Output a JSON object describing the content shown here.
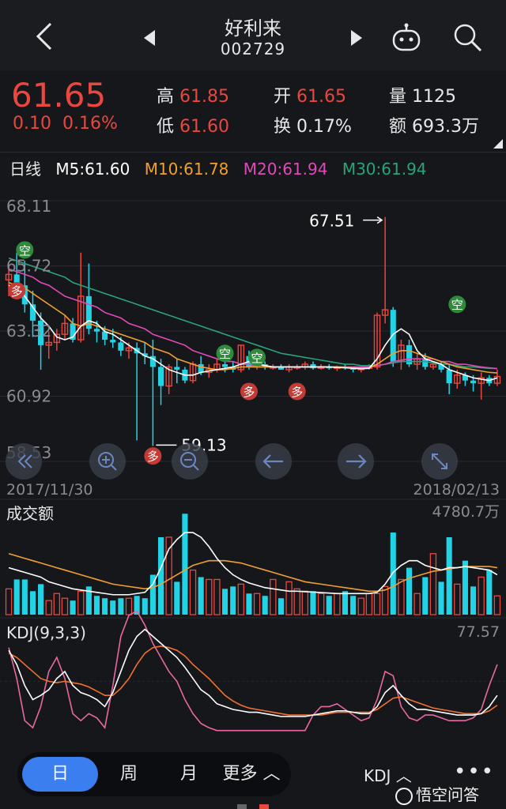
{
  "header": {
    "back_icon": "chevron-left-icon",
    "prev_icon": "triangle-left-icon",
    "next_icon": "triangle-right-icon",
    "title": "好利来",
    "code": "002729",
    "robot_icon": "robot-icon",
    "search_icon": "search-icon"
  },
  "quote": {
    "price": "61.65",
    "change": "0.10",
    "change_pct": "0.16%",
    "high_label": "高",
    "high": "61.85",
    "low_label": "低",
    "low": "61.60",
    "open_label": "开",
    "open": "61.65",
    "turnover_label": "换",
    "turnover": "0.17%",
    "volume_label": "量",
    "volume": "1125",
    "amount_label": "额",
    "amount": "693.3万"
  },
  "ma_bar": {
    "period": "日线",
    "m5": "M5:61.60",
    "m10": "M10:61.78",
    "m20": "M20:61.94",
    "m30": "M30:61.94",
    "colors": {
      "m5": "#ffffff",
      "m10": "#f0a030",
      "m20": "#e04ab8",
      "m30": "#2aa37a"
    }
  },
  "chart_data": [
    {
      "type": "candlestick",
      "y_ticks": [
        "68.11",
        "65.72",
        "63.32",
        "60.92",
        "58.53"
      ],
      "ylim": [
        58.53,
        68.11
      ],
      "x_start": "2017/11/30",
      "x_end": "2018/02/13",
      "annotations": {
        "max_label": "67.51",
        "min_label": "59.13"
      },
      "markers": {
        "short": "空",
        "long": "多"
      },
      "candles": [
        [
          65.2,
          65.6,
          64.6,
          65.4
        ],
        [
          65.4,
          66.2,
          64.9,
          65.0
        ],
        [
          65.0,
          65.9,
          64.0,
          64.3
        ],
        [
          64.3,
          64.8,
          63.1,
          63.7
        ],
        [
          63.7,
          64.0,
          61.9,
          62.8
        ],
        [
          62.8,
          63.3,
          62.3,
          62.9
        ],
        [
          62.9,
          63.4,
          62.6,
          63.2
        ],
        [
          63.2,
          63.9,
          63.0,
          63.6
        ],
        [
          63.6,
          63.8,
          62.9,
          63.0
        ],
        [
          63.0,
          66.2,
          62.9,
          64.6
        ],
        [
          64.6,
          65.8,
          63.2,
          63.4
        ],
        [
          63.4,
          63.7,
          62.9,
          63.3
        ],
        [
          63.3,
          63.5,
          62.8,
          63.0
        ],
        [
          63.0,
          63.4,
          62.7,
          62.9
        ],
        [
          62.9,
          63.1,
          62.4,
          62.6
        ],
        [
          62.6,
          62.9,
          62.3,
          62.7
        ],
        [
          62.7,
          62.9,
          59.3,
          62.5
        ],
        [
          62.5,
          62.9,
          62.1,
          62.4
        ],
        [
          62.4,
          63.0,
          59.1,
          62.0
        ],
        [
          62.0,
          62.3,
          60.6,
          61.3
        ],
        [
          61.3,
          62.1,
          61.0,
          62.0
        ],
        [
          62.0,
          62.3,
          61.4,
          61.9
        ],
        [
          61.9,
          62.0,
          61.4,
          61.5
        ],
        [
          61.5,
          62.2,
          61.4,
          62.1
        ],
        [
          62.1,
          62.4,
          61.7,
          61.8
        ],
        [
          61.8,
          62.1,
          61.6,
          61.9
        ],
        [
          61.9,
          62.3,
          61.8,
          62.1
        ],
        [
          62.1,
          62.5,
          61.8,
          62.0
        ],
        [
          62.0,
          62.2,
          61.8,
          61.9
        ],
        [
          61.9,
          62.8,
          61.8,
          62.8
        ],
        [
          62.4,
          62.6,
          61.9,
          62.0
        ],
        [
          62.0,
          62.2,
          61.9,
          62.1
        ],
        [
          62.1,
          62.2,
          61.9,
          62.0
        ],
        [
          62.0,
          62.1,
          61.9,
          62.0
        ],
        [
          62.0,
          62.1,
          61.9,
          61.9
        ],
        [
          61.9,
          62.1,
          61.8,
          62.0
        ],
        [
          62.0,
          62.1,
          61.9,
          62.0
        ],
        [
          62.0,
          62.2,
          61.9,
          62.1
        ],
        [
          62.1,
          62.2,
          61.9,
          61.95
        ],
        [
          61.95,
          62.1,
          61.9,
          62.0
        ],
        [
          62.0,
          62.1,
          61.9,
          61.95
        ],
        [
          61.95,
          62.05,
          61.85,
          62.0
        ],
        [
          62.0,
          62.1,
          61.9,
          61.95
        ],
        [
          61.95,
          62.0,
          61.8,
          61.9
        ],
        [
          61.9,
          62.0,
          61.8,
          61.95
        ],
        [
          61.95,
          62.1,
          61.9,
          62.0
        ],
        [
          62.0,
          64.0,
          61.9,
          63.9
        ],
        [
          63.9,
          67.51,
          63.6,
          64.1
        ],
        [
          64.1,
          64.2,
          62.0,
          62.2
        ],
        [
          62.2,
          63.0,
          61.9,
          62.8
        ],
        [
          62.8,
          63.0,
          62.0,
          62.1
        ],
        [
          62.1,
          62.5,
          61.9,
          62.3
        ],
        [
          62.3,
          62.5,
          61.9,
          62.0
        ],
        [
          62.0,
          62.2,
          61.9,
          62.1
        ],
        [
          62.1,
          62.2,
          61.8,
          61.9
        ],
        [
          61.9,
          62.1,
          61.0,
          61.4
        ],
        [
          61.4,
          61.9,
          61.2,
          61.7
        ],
        [
          61.7,
          61.8,
          61.3,
          61.5
        ],
        [
          61.5,
          61.7,
          61.1,
          61.4
        ],
        [
          61.4,
          61.8,
          60.8,
          61.6
        ],
        [
          61.6,
          61.7,
          61.3,
          61.4
        ],
        [
          61.4,
          61.9,
          61.3,
          61.65
        ]
      ],
      "ma5": [
        65.0,
        64.9,
        64.6,
        64.2,
        63.8,
        63.5,
        63.1,
        63.0,
        63.1,
        63.5,
        63.7,
        63.6,
        63.3,
        63.2,
        63.0,
        62.8,
        62.6,
        62.4,
        62.3,
        62.1,
        61.9,
        61.8,
        61.7,
        61.7,
        61.8,
        61.85,
        61.9,
        61.95,
        62.0,
        62.1,
        62.2,
        62.1,
        62.05,
        62.0,
        62.0,
        62.0,
        62.0,
        62.0,
        62.0,
        62.0,
        62.0,
        61.98,
        61.97,
        61.95,
        61.93,
        61.95,
        62.3,
        62.8,
        63.2,
        63.4,
        63.2,
        62.6,
        62.3,
        62.2,
        62.1,
        61.9,
        61.8,
        61.7,
        61.6,
        61.55,
        61.5,
        61.6
      ],
      "ma10": [
        65.1,
        65.0,
        64.9,
        64.7,
        64.5,
        64.3,
        64.1,
        63.9,
        63.6,
        63.5,
        63.6,
        63.5,
        63.4,
        63.3,
        63.2,
        63.1,
        63.0,
        62.9,
        62.7,
        62.6,
        62.5,
        62.3,
        62.2,
        62.1,
        62.0,
        61.95,
        61.9,
        61.9,
        61.95,
        62.0,
        62.0,
        62.0,
        62.0,
        62.0,
        62.0,
        62.0,
        62.0,
        62.0,
        62.0,
        62.0,
        62.0,
        62.0,
        61.98,
        61.97,
        61.96,
        61.96,
        62.1,
        62.3,
        62.5,
        62.6,
        62.6,
        62.5,
        62.4,
        62.3,
        62.2,
        62.1,
        62.0,
        61.95,
        61.9,
        61.85,
        61.8,
        61.78
      ],
      "ma20": [
        65.6,
        65.5,
        65.4,
        65.3,
        65.1,
        65.0,
        64.8,
        64.6,
        64.5,
        64.4,
        64.3,
        64.2,
        64.0,
        63.9,
        63.8,
        63.6,
        63.5,
        63.4,
        63.2,
        63.1,
        63.0,
        62.9,
        62.8,
        62.6,
        62.5,
        62.4,
        62.3,
        62.2,
        62.2,
        62.1,
        62.1,
        62.0,
        62.0,
        62.0,
        62.0,
        62.0,
        62.0,
        62.0,
        62.0,
        62.0,
        62.0,
        62.0,
        62.0,
        62.0,
        62.0,
        62.0,
        62.05,
        62.1,
        62.2,
        62.25,
        62.3,
        62.3,
        62.3,
        62.3,
        62.2,
        62.2,
        62.1,
        62.1,
        62.05,
        62.0,
        61.97,
        61.94
      ],
      "ma30": [
        66.0,
        65.9,
        65.8,
        65.7,
        65.6,
        65.5,
        65.4,
        65.3,
        65.1,
        65.0,
        64.9,
        64.8,
        64.7,
        64.6,
        64.5,
        64.4,
        64.3,
        64.2,
        64.1,
        64.0,
        63.9,
        63.8,
        63.7,
        63.6,
        63.5,
        63.4,
        63.3,
        63.2,
        63.1,
        63.0,
        62.9,
        62.8,
        62.7,
        62.6,
        62.5,
        62.45,
        62.4,
        62.35,
        62.3,
        62.25,
        62.2,
        62.15,
        62.1,
        62.1,
        62.05,
        62.05,
        62.05,
        62.1,
        62.15,
        62.2,
        62.2,
        62.2,
        62.2,
        62.15,
        62.1,
        62.1,
        62.05,
        62.0,
        62.0,
        61.97,
        61.95,
        61.94
      ]
    },
    {
      "type": "bar",
      "label": "成交额",
      "max_label": "4780.7万",
      "ylim": [
        0,
        4780.7
      ],
      "values": [
        1100,
        1500,
        1500,
        1000,
        1300,
        600,
        900,
        700,
        600,
        1000,
        1200,
        800,
        700,
        600,
        700,
        700,
        800,
        700,
        1700,
        3300,
        3300,
        1400,
        4300,
        1900,
        1600,
        1500,
        1500,
        1100,
        1200,
        1300,
        900,
        900,
        800,
        1500,
        700,
        1400,
        1100,
        1000,
        1000,
        900,
        800,
        900,
        1000,
        800,
        700,
        900,
        900,
        1200,
        3500,
        1500,
        2000,
        900,
        1600,
        2600,
        1400,
        3300,
        1300,
        2300,
        1200,
        1600,
        1900,
        800
      ],
      "ma_white": [
        2000,
        1900,
        1800,
        1700,
        1600,
        1400,
        1300,
        1200,
        1100,
        1050,
        1000,
        950,
        900,
        850,
        850,
        850,
        900,
        950,
        1300,
        2000,
        2800,
        3200,
        3500,
        3500,
        3300,
        2900,
        2400,
        2000,
        1700,
        1500,
        1350,
        1250,
        1150,
        1100,
        1050,
        1000,
        1000,
        980,
        960,
        940,
        920,
        900,
        900,
        900,
        900,
        900,
        950,
        1300,
        1800,
        2100,
        2300,
        2300,
        2100,
        2000,
        1900,
        2000,
        2000,
        2050,
        2000,
        1950,
        1900,
        1700
      ],
      "ma_orange": [
        2600,
        2500,
        2400,
        2300,
        2200,
        2100,
        2000,
        1900,
        1800,
        1700,
        1600,
        1500,
        1400,
        1300,
        1250,
        1200,
        1150,
        1100,
        1150,
        1300,
        1500,
        1700,
        1900,
        2100,
        2200,
        2300,
        2300,
        2300,
        2250,
        2200,
        2100,
        2000,
        1900,
        1800,
        1700,
        1600,
        1500,
        1400,
        1350,
        1300,
        1250,
        1200,
        1150,
        1100,
        1050,
        1000,
        1000,
        1050,
        1200,
        1400,
        1550,
        1650,
        1750,
        1850,
        1900,
        1950,
        2000,
        2050,
        2050,
        2050,
        2050,
        2000
      ]
    },
    {
      "type": "line",
      "label": "KDJ(9,3,3)",
      "max_label": "77.57",
      "ylim": [
        0,
        77.57
      ],
      "k": [
        60,
        50,
        35,
        25,
        28,
        32,
        40,
        45,
        35,
        30,
        28,
        25,
        20,
        30,
        45,
        60,
        70,
        75,
        70,
        65,
        60,
        55,
        48,
        40,
        32,
        28,
        22,
        20,
        18,
        17,
        16,
        16,
        15,
        14,
        13,
        13,
        13,
        13,
        14,
        15,
        16,
        17,
        17,
        16,
        15,
        15,
        20,
        30,
        35,
        28,
        22,
        18,
        18,
        17,
        16,
        15,
        14,
        14,
        14,
        15,
        20,
        28
      ],
      "d": [
        58,
        55,
        50,
        45,
        40,
        38,
        37,
        38,
        37,
        36,
        34,
        31,
        28,
        28,
        33,
        40,
        50,
        58,
        62,
        63,
        62,
        60,
        56,
        50,
        45,
        40,
        34,
        28,
        24,
        21,
        19,
        18,
        17,
        16,
        15,
        14,
        14,
        14,
        14,
        14,
        15,
        16,
        16,
        16,
        16,
        16,
        18,
        22,
        26,
        27,
        25,
        23,
        21,
        19,
        18,
        17,
        16,
        15,
        15,
        15,
        17,
        21
      ],
      "j": [
        62,
        40,
        10,
        5,
        20,
        45,
        55,
        40,
        15,
        10,
        15,
        12,
        5,
        35,
        70,
        85,
        88,
        78,
        65,
        55,
        45,
        38,
        25,
        15,
        8,
        5,
        3,
        3,
        3,
        3,
        3,
        3,
        3,
        3,
        3,
        3,
        3,
        3,
        14,
        20,
        20,
        22,
        18,
        14,
        10,
        12,
        25,
        45,
        42,
        20,
        12,
        10,
        14,
        14,
        12,
        10,
        10,
        10,
        12,
        18,
        35,
        50
      ],
      "colors": {
        "k": "#ffffff",
        "d": "#f07030",
        "j": "#e868a0"
      }
    }
  ],
  "overlay": {
    "icons": [
      "scroll-left-icon",
      "zoom-in-icon",
      "zoom-out-icon",
      "arrow-left-icon",
      "arrow-right-icon",
      "fullscreen-icon"
    ]
  },
  "bottom": {
    "tabs": [
      "日",
      "周",
      "月",
      "更多"
    ],
    "more_icon": "chevron-up-icon",
    "indicator": "KDJ",
    "dots": "•••",
    "watermark": "悟空问答"
  },
  "colors": {
    "up": "#e9473f",
    "down": "#22d3e6",
    "bg": "#16171b"
  }
}
